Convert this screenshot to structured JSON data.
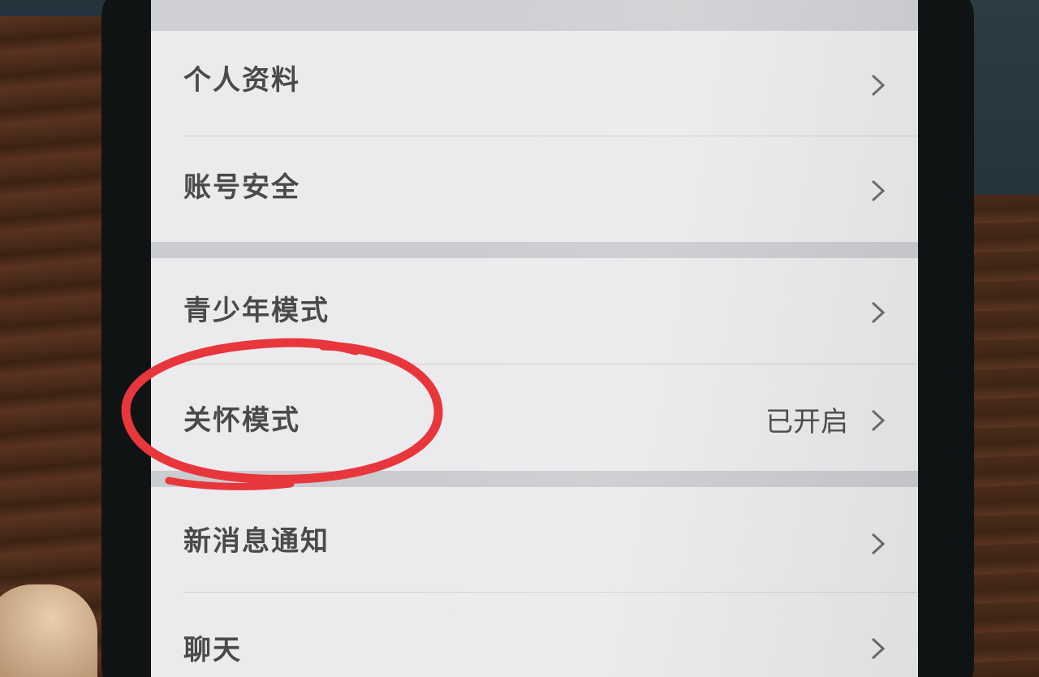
{
  "settings_list": {
    "items": [
      {
        "label": "个人资料",
        "value": ""
      },
      {
        "label": "账号安全",
        "value": ""
      },
      {
        "label": "青少年模式",
        "value": ""
      },
      {
        "label": "关怀模式",
        "value": "已开启"
      },
      {
        "label": "新消息通知",
        "value": ""
      },
      {
        "label": "聊天",
        "value": ""
      }
    ]
  },
  "annotation": {
    "shape": "hand-drawn-circle",
    "color": "#e8373c",
    "target": "关怀模式"
  },
  "icons": {
    "row_chevron": "chevron-right-icon"
  }
}
